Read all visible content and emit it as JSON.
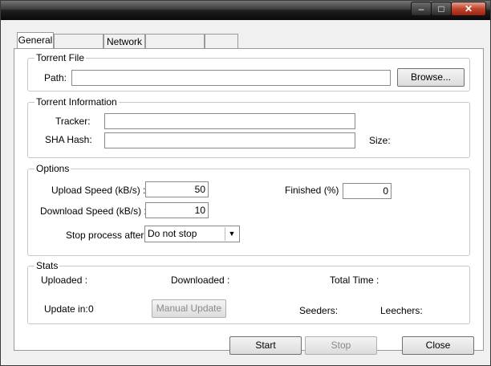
{
  "tabs": [
    "General",
    "",
    "Network",
    "",
    ""
  ],
  "torrent_file": {
    "legend": "Torrent File",
    "path_label": "Path:",
    "path_value": "",
    "browse_label": "Browse..."
  },
  "torrent_info": {
    "legend": "Torrent Information",
    "tracker_label": "Tracker:",
    "tracker_value": "",
    "sha_label": "SHA Hash:",
    "sha_value": "",
    "size_label": "Size:"
  },
  "options": {
    "legend": "Options",
    "upload_label": "Upload Speed (kB/s) :",
    "upload_value": "50",
    "download_label": "Download Speed (kB/s) :",
    "download_value": "10",
    "finished_label": "Finished (%)",
    "finished_value": "0",
    "stop_label": "Stop process after:",
    "stop_value": "Do not stop"
  },
  "stats": {
    "legend": "Stats",
    "uploaded_label": "Uploaded :",
    "downloaded_label": "Downloaded :",
    "total_time_label": "Total Time :",
    "update_in_label": "Update in:",
    "update_in_value": "0",
    "manual_update_label": "Manual Update",
    "seeders_label": "Seeders:",
    "leechers_label": "Leechers:"
  },
  "footer": {
    "start_label": "Start",
    "stop_label": "Stop",
    "close_label": "Close"
  },
  "window_controls": {
    "minimize": "–",
    "maximize": "□",
    "close": "✕"
  }
}
